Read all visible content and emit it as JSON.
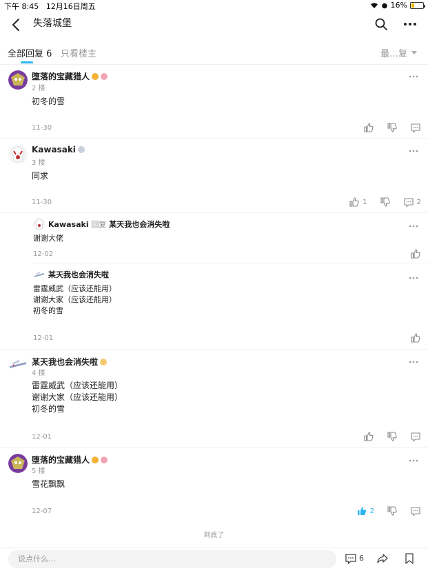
{
  "status": {
    "time": "下午 8:45",
    "date": "12月16日周五",
    "battery": "16%"
  },
  "nav": {
    "title": "失落城堡"
  },
  "tabs": {
    "all": "全部回复 6",
    "owner": "只看楼主",
    "sort": "最…复"
  },
  "floors": [
    {
      "name": "堕落的宝藏猎人",
      "floor": "2 楼",
      "lines": [
        "初冬的雪"
      ],
      "date": "11-30",
      "like_count": "",
      "comment_count": ""
    },
    {
      "name": "Kawasaki",
      "floor": "3 楼",
      "lines": [
        "同求"
      ],
      "date": "11-30",
      "like_count": "1",
      "comment_count": "2"
    },
    {
      "name": "某天我也会消失啦",
      "floor": "4 楼",
      "lines": [
        "雷霆威武（应该还能用）",
        "谢谢大家（应该还能用）",
        "初冬的雪"
      ],
      "date": "12-01",
      "like_count": "",
      "comment_count": ""
    },
    {
      "name": "堕落的宝藏猎人",
      "floor": "5 楼",
      "lines": [
        "雪花飘飘"
      ],
      "date": "12-07",
      "like_count": "2",
      "comment_count": ""
    }
  ],
  "subreplies": [
    {
      "name": "Kawasaki",
      "reply_word": "回复",
      "target": "某天我也会消失啦",
      "lines": [
        "谢谢大佬"
      ],
      "date": "12-02"
    },
    {
      "name": "某天我也会消失啦",
      "reply_word": "",
      "target": "",
      "lines": [
        "雷霆威武（应该还能用）",
        "谢谢大家（应该还能用）",
        "初冬的雪"
      ],
      "date": "12-01"
    }
  ],
  "end_text": "到底了",
  "bottom": {
    "placeholder": "说点什么...",
    "comment_count": "6"
  },
  "colors": {
    "accent": "#2bb5f0",
    "liked": "#2bb5f0"
  }
}
